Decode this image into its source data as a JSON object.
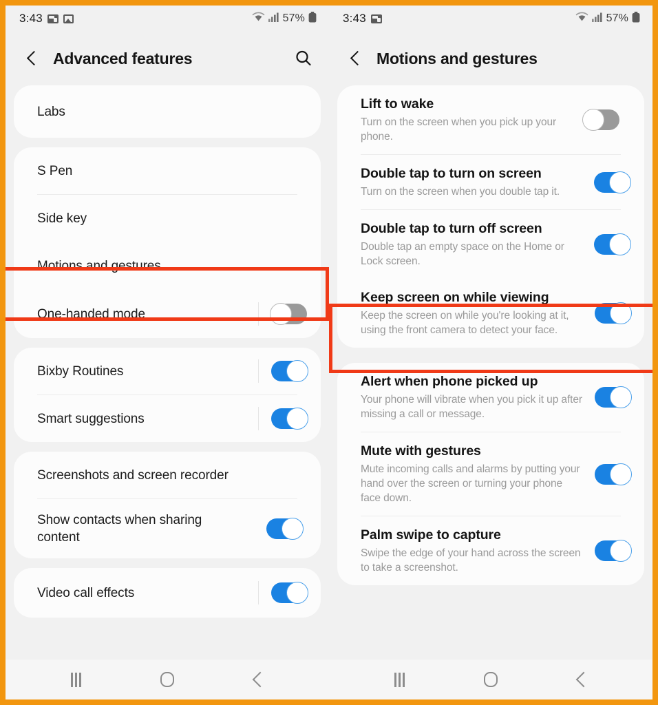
{
  "colors": {
    "frame_orange": "#f2960f",
    "highlight_red": "#f03a17",
    "toggle_on_blue": "#1a82e2",
    "toggle_off_gray": "#9a9a9a",
    "page_bg": "#f1f1f1",
    "card_bg": "#fcfcfc"
  },
  "left_panel": {
    "statusbar": {
      "time": "3:43",
      "battery": "57%",
      "icons": [
        "screenshot-icon",
        "gallery-icon",
        "wifi-icon",
        "signal-icon",
        "battery-icon"
      ]
    },
    "header": {
      "back_icon": "back-chevron-icon",
      "title": "Advanced features",
      "search_icon": "search-icon"
    },
    "groups": [
      {
        "rows": [
          {
            "title": "Labs",
            "sub": "",
            "toggle": null
          }
        ]
      },
      {
        "rows": [
          {
            "title": "S Pen",
            "sub": "",
            "toggle": null
          },
          {
            "title": "Side key",
            "sub": "",
            "toggle": null
          },
          {
            "title": "Motions and gestures",
            "sub": "",
            "toggle": null,
            "highlighted": true
          },
          {
            "title": "One-handed mode",
            "sub": "",
            "toggle": "off"
          }
        ]
      },
      {
        "rows": [
          {
            "title": "Bixby Routines",
            "sub": "",
            "toggle": "on"
          },
          {
            "title": "Smart suggestions",
            "sub": "",
            "toggle": "on"
          }
        ]
      },
      {
        "rows": [
          {
            "title": "Screenshots and screen recorder",
            "sub": "",
            "toggle": null
          },
          {
            "title": "Show contacts when sharing content",
            "sub": "",
            "toggle": "on"
          }
        ]
      },
      {
        "rows": [
          {
            "title": "Video call effects",
            "sub": "",
            "toggle": "on"
          }
        ]
      }
    ],
    "navbar": {
      "recents": "recents-icon",
      "home": "home-icon",
      "back": "back-icon"
    }
  },
  "right_panel": {
    "statusbar": {
      "time": "3:43",
      "battery": "57%",
      "icons": [
        "screenshot-icon",
        "wifi-icon",
        "signal-icon",
        "battery-icon"
      ]
    },
    "header": {
      "back_icon": "back-chevron-icon",
      "title": "Motions and gestures"
    },
    "groups": [
      {
        "rows": [
          {
            "title": "Lift to wake",
            "sub": "Turn on the screen when you pick up your phone.",
            "toggle": "off"
          },
          {
            "title": "Double tap to turn on screen",
            "sub": "Turn on the screen when you double tap it.",
            "toggle": "on"
          },
          {
            "title": "Double tap to turn off screen",
            "sub": "Double tap an empty space on the Home or Lock screen.",
            "toggle": "on"
          },
          {
            "title": "Keep screen on while viewing",
            "sub": "Keep the screen on while you're looking at it, using the front camera to detect your face.",
            "toggle": "on",
            "highlighted": true
          }
        ]
      },
      {
        "rows": [
          {
            "title": "Alert when phone picked up",
            "sub": "Your phone will vibrate when you pick it up after missing a call or message.",
            "toggle": "on"
          },
          {
            "title": "Mute with gestures",
            "sub": "Mute incoming calls and alarms by putting your hand over the screen or turning your phone face down.",
            "toggle": "on"
          },
          {
            "title": "Palm swipe to capture",
            "sub": "Swipe the edge of your hand across the screen to take a screenshot.",
            "toggle": "on"
          }
        ]
      }
    ],
    "navbar": {
      "recents": "recents-icon",
      "home": "home-icon",
      "back": "back-icon"
    }
  }
}
